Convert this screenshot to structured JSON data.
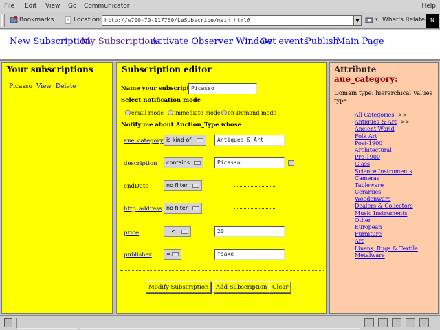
{
  "menubar": {
    "items": [
      "File",
      "Edit",
      "View",
      "Go",
      "Communicator"
    ],
    "help": "Help"
  },
  "location_bar": {
    "bookmarks_label": "Bookmarks",
    "location_label": "Location:",
    "url": "http://w700-70-117760/LeSubscribe/main.html#",
    "whats_related": "What's Related",
    "logo_text": "N"
  },
  "top_nav": {
    "links": [
      {
        "label": "New Subscription",
        "visited": false
      },
      {
        "label": "My Subscriptions",
        "visited": true
      },
      {
        "label": "Activate Observer Window",
        "visited": false
      },
      {
        "label": "Get events",
        "visited": false
      },
      {
        "label": "Publish",
        "visited": false
      },
      {
        "label": "Main Page",
        "visited": false
      }
    ]
  },
  "left_panel": {
    "title": "Your subscriptions",
    "subscription_name": "Picasso",
    "view_link": "View",
    "delete_link": "Delete"
  },
  "editor": {
    "title": "Subscription editor",
    "name_label": "Name your subscription",
    "name_value": "Picasso",
    "mode_label": "Select notification mode",
    "modes": [
      "email mode",
      "immediate mode",
      "on-Demand mode"
    ],
    "notify_label": "Notify me about Auction_Type whose",
    "rows": [
      {
        "attr": "aue_category",
        "is_link": true,
        "operator": "is kind of",
        "value": "Antiques & Art",
        "has_value_field": true
      },
      {
        "attr": "description",
        "is_link": true,
        "operator": "contains",
        "value": "Picasso",
        "has_value_field": true
      },
      {
        "attr": "endDate",
        "is_link": false,
        "operator": "no filter",
        "value": "",
        "has_value_field": false
      },
      {
        "attr": "http_address",
        "is_link": true,
        "operator": "no filter",
        "value": "",
        "has_value_field": false
      },
      {
        "attr": "price",
        "is_link": true,
        "operator": "<",
        "value": "20",
        "has_value_field": true
      },
      {
        "attr": "publisher",
        "is_link": true,
        "operator": "=",
        "value": "fsaxe",
        "has_value_field": true
      }
    ],
    "buttons": {
      "modify": "Modify Subscription",
      "add": "Add Subscription",
      "clear": "Clear"
    }
  },
  "attribute_panel": {
    "heading": "Attribute",
    "name": "aue_category:",
    "description": "Domain type: hierarchical Values type.",
    "categories": [
      {
        "label": "All Categories",
        "arrow": "->>"
      },
      {
        "label": "Antiques & Art",
        "arrow": "->>"
      },
      {
        "label": "Ancient World",
        "arrow": ""
      },
      {
        "label": "Folk Art",
        "arrow": ""
      },
      {
        "label": "Post-1900",
        "arrow": ""
      },
      {
        "label": "Architectural",
        "arrow": ""
      },
      {
        "label": "Pre-1900",
        "arrow": ""
      },
      {
        "label": "Glass",
        "arrow": ""
      },
      {
        "label": "Science Instruments",
        "arrow": ""
      },
      {
        "label": "Cameras",
        "arrow": ""
      },
      {
        "label": "Tableware",
        "arrow": ""
      },
      {
        "label": "Ceramics",
        "arrow": ""
      },
      {
        "label": "Woodenware",
        "arrow": ""
      },
      {
        "label": "Dealers & Collectors",
        "arrow": ""
      },
      {
        "label": "Music Instruments",
        "arrow": ""
      },
      {
        "label": "Other",
        "arrow": ""
      },
      {
        "label": "European",
        "arrow": ""
      },
      {
        "label": "Furniture",
        "arrow": ""
      },
      {
        "label": "Art",
        "arrow": ""
      },
      {
        "label": "Linens, Rugs & Textile",
        "arrow": ""
      },
      {
        "label": "Metalware",
        "arrow": ""
      }
    ]
  }
}
